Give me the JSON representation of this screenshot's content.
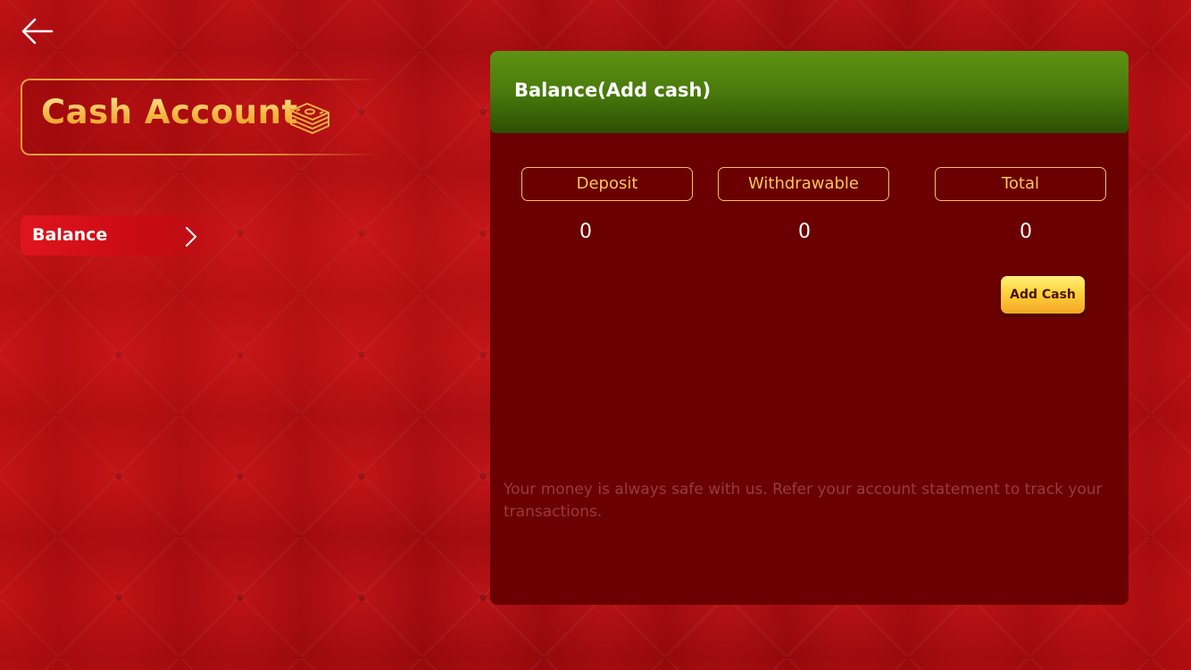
{
  "header": {
    "title": "Cash Account",
    "back_icon": "arrow-left-icon",
    "title_icon": "money-stack-icon"
  },
  "sidebar": {
    "items": [
      {
        "label": "Balance",
        "icon": "chevron-right-icon",
        "selected": true
      }
    ]
  },
  "panel": {
    "title": "Balance(Add cash)",
    "columns": [
      {
        "label": "Deposit",
        "value": "0"
      },
      {
        "label": "Withdrawable",
        "value": "0"
      },
      {
        "label": "Total",
        "value": "0"
      }
    ],
    "add_cash_label": "Add Cash",
    "note": "Your money is always safe with us. Refer your account statement to track your transactions."
  },
  "colors": {
    "background": "#a80a0f",
    "panel": "#6b0000",
    "header_green": "#4a7a0c",
    "gold": "#f7c65a",
    "menu_active": "#e0141e"
  }
}
